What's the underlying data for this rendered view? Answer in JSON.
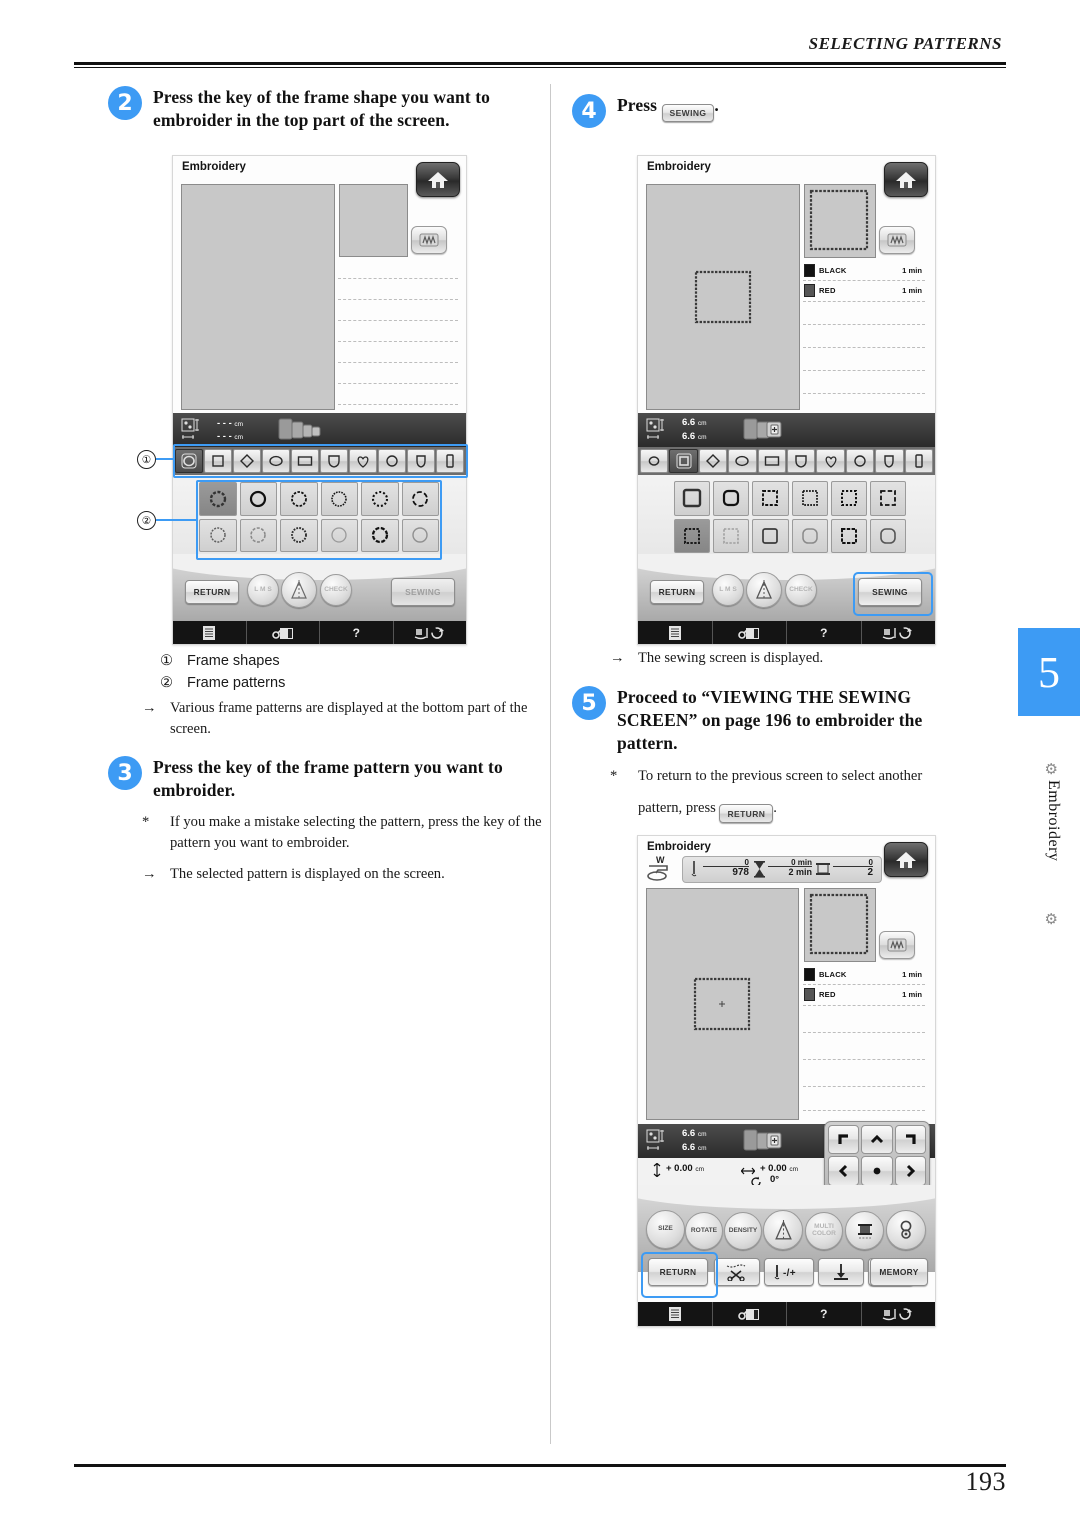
{
  "header": {
    "running_head": "SELECTING PATTERNS"
  },
  "folio": "193",
  "chapter_tab": {
    "number": "5",
    "label": "Embroidery",
    "color": "#3d9bf4"
  },
  "steps": [
    {
      "num": "2",
      "text": "Press the key of the frame shape you want to embroider in the top part of the screen."
    },
    {
      "num": "3",
      "text": "Press the key of the frame pattern you want to embroider."
    },
    {
      "num": "4",
      "text_before": "Press",
      "key_label": "SEWING",
      "text_after": "."
    },
    {
      "num": "5",
      "text": "Proceed to “VIEWING THE SEWING SCREEN” on page 196 to embroider the pattern."
    }
  ],
  "callouts": {
    "one_mark": "①",
    "one_label": "Frame shapes",
    "two_mark": "②",
    "two_label": "Frame patterns",
    "arrow_mark": "→",
    "arrow_label": "Various frame patterns are displayed at the bottom part of the screen."
  },
  "notes": {
    "step3_star_mark": "*",
    "step3_star": "If you make a mistake selecting the pattern, press the key of the pattern you want to embroider.",
    "step3_arrow_mark": "→",
    "step3_arrow": "The selected pattern is displayed on the screen.",
    "step4_arrow_mark": "→",
    "step4_arrow": "The sewing screen is displayed.",
    "step5_star_mark": "*",
    "step5_star_before": "To return to the previous screen to select another",
    "step5_star_line2": "pattern, press",
    "step5_key": "RETURN",
    "step5_star_after": "."
  },
  "screen_left": {
    "title": "Embroidery",
    "size_w": "- - -",
    "size_h": "- - -",
    "unit": "cm",
    "shape_keys": [
      "oval-ring-shape",
      "square-shape",
      "diamond-shape",
      "ellipse-shape",
      "rectangle-shape",
      "shield-shape",
      "heart-shape",
      "circle-shape",
      "crest-shape",
      "tall-rect-shape"
    ],
    "selected_shape_index": 0,
    "pattern_count": 12,
    "pattern_kind": "circle",
    "selected_pattern_index": 0,
    "buttons": {
      "return": "RETURN",
      "lms": "L M S",
      "mirror": "mirror-icon",
      "check": "CHECK",
      "sewing": "SEWING"
    },
    "bottom_bar": [
      "manual-icon",
      "machine-setting-icon",
      "?",
      "thread-guide-icon"
    ]
  },
  "screen_right_top": {
    "title": "Embroidery",
    "size_w": "6.6",
    "size_h": "6.6",
    "unit": "cm",
    "shape_keys": [
      "circle-shape",
      "square-frame-shape",
      "diamond-shape",
      "ellipse-shape",
      "rectangle-shape",
      "shield-shape",
      "heart-shape",
      "circle-shape",
      "crest-shape",
      "tall-rect-shape"
    ],
    "selected_shape_index": 1,
    "pattern_count": 12,
    "pattern_kind": "square",
    "selected_pattern_index": 6,
    "threads": [
      {
        "name": "BLACK",
        "time": "1 min",
        "color": "#111111"
      },
      {
        "name": "RED",
        "time": "1 min",
        "color": "#555555"
      }
    ],
    "buttons": {
      "return": "RETURN",
      "lms": "L M S",
      "mirror": "mirror-icon",
      "check": "CHECK",
      "sewing": "SEWING"
    },
    "highlight": "sewing",
    "bottom_bar": [
      "manual-icon",
      "machine-setting-icon",
      "?",
      "thread-guide-icon"
    ]
  },
  "screen_right_bottom": {
    "title": "Embroidery",
    "presser_label": "W",
    "counters": {
      "stitch_current": "0",
      "stitch_total": "978",
      "time_current": "0 min",
      "time_total": "2 min",
      "color_current": "0",
      "color_total": "2"
    },
    "size_w": "6.6",
    "size_h": "6.6",
    "unit": "cm",
    "position": {
      "vertical": "+ 0.00",
      "horizontal": "+ 0.00",
      "rotation": "0°",
      "unit": "cm"
    },
    "threads": [
      {
        "name": "BLACK",
        "time": "1 min",
        "color": "#111111"
      },
      {
        "name": "RED",
        "time": "1 min",
        "color": "#555555"
      }
    ],
    "edit_keys": [
      "SIZE",
      "ROTATE",
      "DENSITY",
      "mirror-icon",
      "MULTI COLOR",
      "thread-icon",
      "figure-eight-icon"
    ],
    "function_keys": [
      "RETURN",
      "thread-cut-icon",
      "stitch-step-icon",
      "needle-down-icon",
      "trial-frame-icon",
      "MEMORY"
    ],
    "highlight": "return",
    "bottom_bar": [
      "manual-icon",
      "machine-setting-icon",
      "?",
      "thread-guide-icon"
    ]
  }
}
